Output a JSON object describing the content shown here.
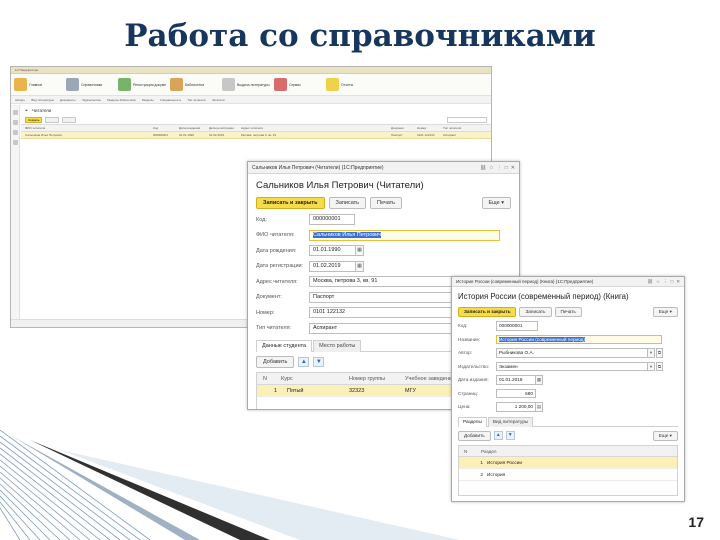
{
  "slide": {
    "title": "Работа со справочниками",
    "page_number": "17"
  },
  "main_window": {
    "title": "1С:Предприятие",
    "sections": [
      {
        "label": "Главное",
        "color": "#e9b44c"
      },
      {
        "label": "Справочники",
        "color": "#9aa7b5"
      },
      {
        "label": "Регистрация документов",
        "color": "#78b36a"
      },
      {
        "label": "Библиотека",
        "color": "#d9a35a"
      },
      {
        "label": "Выдача литературы",
        "color": "#c7c7c7"
      },
      {
        "label": "Сервис",
        "color": "#d86b6b"
      },
      {
        "label": "Отчеты",
        "color": "#f0d24a"
      }
    ],
    "command_bar": [
      "Авторы",
      "Вид литературы",
      "Документы",
      "Издательства",
      "Разделы библиотеки",
      "Разделы",
      "Специальность",
      "Тип читателя",
      "Читатели"
    ],
    "list_title": "Читатели",
    "create_button": "Создать",
    "grid_columns": [
      "ФИО читателя",
      "Код",
      "Дата рождения",
      "Дата регистрации",
      "Адрес читателя",
      "Документ",
      "Номер",
      "Тип читателя"
    ],
    "grid_row": [
      "Сальников Илья Петрович",
      "000000001",
      "01.01.1990",
      "01.02.2019",
      "Москва, петрова 3, кв. 91",
      "Паспорт",
      "0101 122132",
      "Аспирант"
    ]
  },
  "reader_form": {
    "window_title": "Сальников Илья Петрович (Читатели) (1С:Предприятие)",
    "heading": "Сальников Илья Петрович (Читатели)",
    "buttons": {
      "save_close": "Записать и закрыть",
      "save": "Записать",
      "print": "Печать",
      "more": "Еще"
    },
    "fields": {
      "code": {
        "label": "Код:",
        "value": "000000001"
      },
      "name": {
        "label": "ФИО читателя:",
        "value": "Сальников Илья Петрович"
      },
      "birth": {
        "label": "Дата рождения:",
        "value": "01.01.1990"
      },
      "registration": {
        "label": "Дата регистрации:",
        "value": "01.02.2019"
      },
      "address": {
        "label": "Адрес читателя:",
        "value": "Москва, петрова 3, кв. 91"
      },
      "document": {
        "label": "Документ:",
        "value": "Паспорт"
      },
      "number": {
        "label": "Номер:",
        "value": "0101 122132"
      },
      "reader_type": {
        "label": "Тип читателя:",
        "value": "Аспирант"
      }
    },
    "tabs": [
      "Данные студента",
      "Место работы"
    ],
    "add_button": "Добавить",
    "table": {
      "columns": [
        "N",
        "Курс",
        "Номер группы",
        "Учебное заведение"
      ],
      "rows": [
        [
          "1",
          "Пятый",
          "32323",
          "МГУ"
        ]
      ]
    }
  },
  "book_form": {
    "window_title": "История России (современный период) (Книга) (1С:Предприятие)",
    "heading": "История России (современный период) (Книга)",
    "buttons": {
      "save_close": "Записать и закрыть",
      "save": "Записать",
      "print": "Печать",
      "more": "Еще"
    },
    "fields": {
      "code": {
        "label": "Код:",
        "value": "000000001"
      },
      "name": {
        "label": "Название:",
        "value": "История России (современный период)"
      },
      "author": {
        "label": "Автор:",
        "value": "Рыбникова О.А."
      },
      "publisher": {
        "label": "Издательство:",
        "value": "Экзамен"
      },
      "publish_date": {
        "label": "Дата издания:",
        "value": "01.01.2018"
      },
      "pages": {
        "label": "Страниц:",
        "value": "680"
      },
      "price": {
        "label": "Цена:",
        "value": "1 200,00"
      }
    },
    "tabs": [
      "Разделы",
      "Вид литературы"
    ],
    "add_button": "Добавить",
    "more": "Еще",
    "table": {
      "columns": [
        "N",
        "Раздел"
      ],
      "rows": [
        [
          "1",
          "История России"
        ],
        [
          "2",
          "История"
        ]
      ]
    }
  }
}
